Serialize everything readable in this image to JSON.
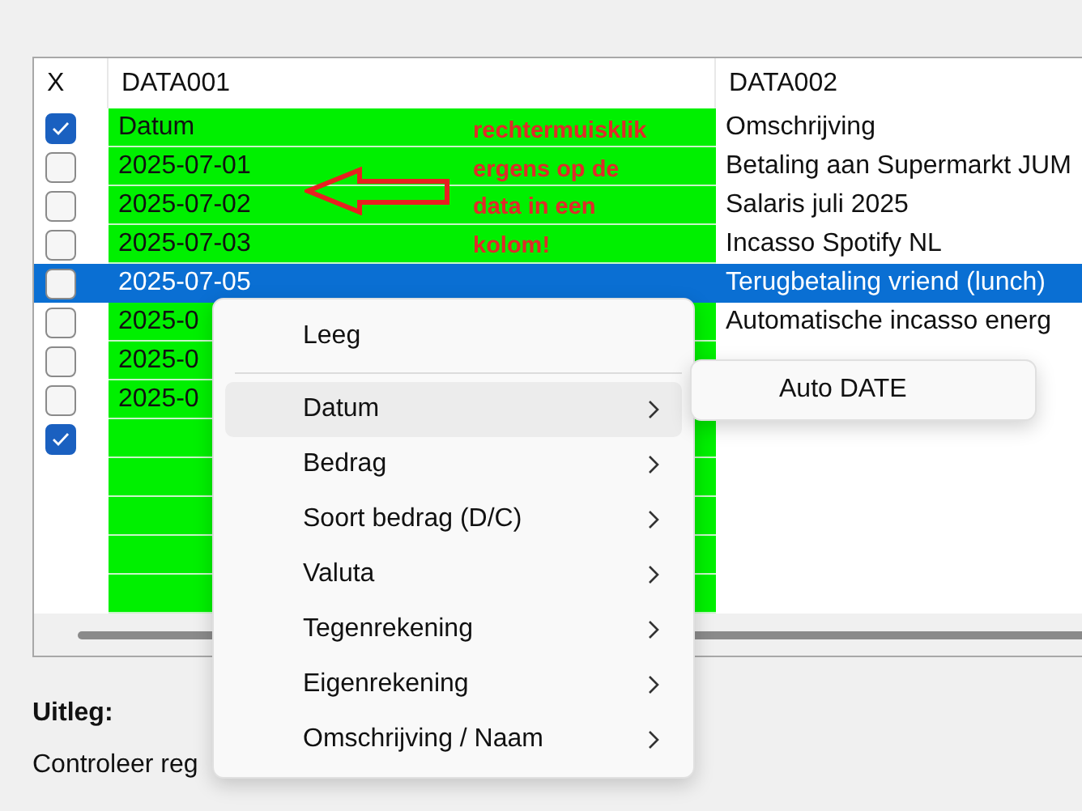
{
  "table": {
    "columns": [
      "X",
      "DATA001",
      "DATA002"
    ],
    "rows": [
      {
        "checked": true,
        "selected": false,
        "data001": "Datum",
        "data002": "Omschrijving"
      },
      {
        "checked": false,
        "selected": false,
        "data001": "2025-07-01",
        "data002": "Betaling aan Supermarkt JUM"
      },
      {
        "checked": false,
        "selected": false,
        "data001": "2025-07-02",
        "data002": "Salaris juli 2025"
      },
      {
        "checked": false,
        "selected": false,
        "data001": "2025-07-03",
        "data002": "Incasso Spotify NL"
      },
      {
        "checked": false,
        "selected": true,
        "data001": "2025-07-05",
        "data002": "Terugbetaling vriend (lunch)"
      },
      {
        "checked": false,
        "selected": false,
        "data001": "2025-0",
        "data002": "Automatische incasso energ"
      },
      {
        "checked": false,
        "selected": false,
        "data001": "2025-0"
      },
      {
        "checked": false,
        "selected": false,
        "data001": "2025-0"
      },
      {
        "checked": true,
        "selected": false
      }
    ]
  },
  "annotation": {
    "lines": [
      "rechtermuisklik",
      "ergens op de",
      "data in een",
      "kolom!"
    ]
  },
  "context_menu": {
    "items": [
      {
        "kind": "plain",
        "label": "Leeg",
        "highlighted": false
      },
      {
        "kind": "separator"
      },
      {
        "kind": "submenu",
        "label": "Datum",
        "highlighted": true
      },
      {
        "kind": "submenu",
        "label": "Bedrag",
        "highlighted": false
      },
      {
        "kind": "submenu",
        "label": "Soort bedrag (D/C)",
        "highlighted": false
      },
      {
        "kind": "submenu",
        "label": "Valuta",
        "highlighted": false
      },
      {
        "kind": "submenu",
        "label": "Tegenrekening",
        "highlighted": false
      },
      {
        "kind": "submenu",
        "label": "Eigenrekening",
        "highlighted": false
      },
      {
        "kind": "submenu",
        "label": "Omschrijving / Naam",
        "highlighted": false
      }
    ]
  },
  "submenu": {
    "items": [
      {
        "label": "Auto DATE"
      }
    ]
  },
  "explanation": {
    "heading": "Uitleg:",
    "text": "Controleer reg"
  }
}
